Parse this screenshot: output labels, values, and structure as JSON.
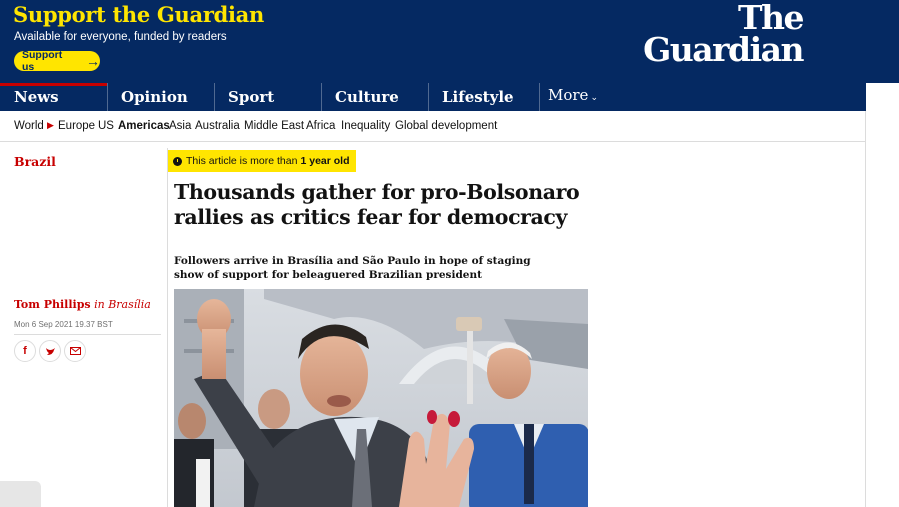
{
  "banner": {
    "title": "Support the Guardian",
    "subtitle": "Available for everyone, funded by readers",
    "button_label": "Support us",
    "button_arrow": "→"
  },
  "logo": {
    "line1": "The",
    "line2": "Guardian"
  },
  "nav": {
    "items": [
      {
        "label": "News"
      },
      {
        "label": "Opinion"
      },
      {
        "label": "Sport"
      },
      {
        "label": "Culture"
      },
      {
        "label": "Lifestyle"
      }
    ],
    "more_label": "More",
    "more_chevron": "⌄"
  },
  "subnav": {
    "items": [
      "World",
      "Europe",
      "US",
      "Americas",
      "Asia",
      "Australia",
      "Middle East",
      "Africa",
      "Inequality",
      "Global development"
    ],
    "selected": "Americas",
    "separator": "▶"
  },
  "article": {
    "section": "Brazil",
    "age_notice_prefix": "This article is more than",
    "age_notice_bold": "1 year old",
    "headline": "Thousands gather for pro-Bolsonaro rallies as critics fear for democracy",
    "standfirst": "Followers arrive in Brasília and São Paulo in hope of staging show of support for beleaguered Brazilian president",
    "author": "Tom Phillips",
    "location": "in Brasília",
    "date": "Mon 6 Sep 2021 19.37 BST",
    "share": {
      "facebook": "f",
      "twitter": "♥",
      "email": "✉"
    }
  },
  "colors": {
    "brand_blue": "#052962",
    "support_yellow": "#ffe500",
    "news_red": "#c70000"
  }
}
